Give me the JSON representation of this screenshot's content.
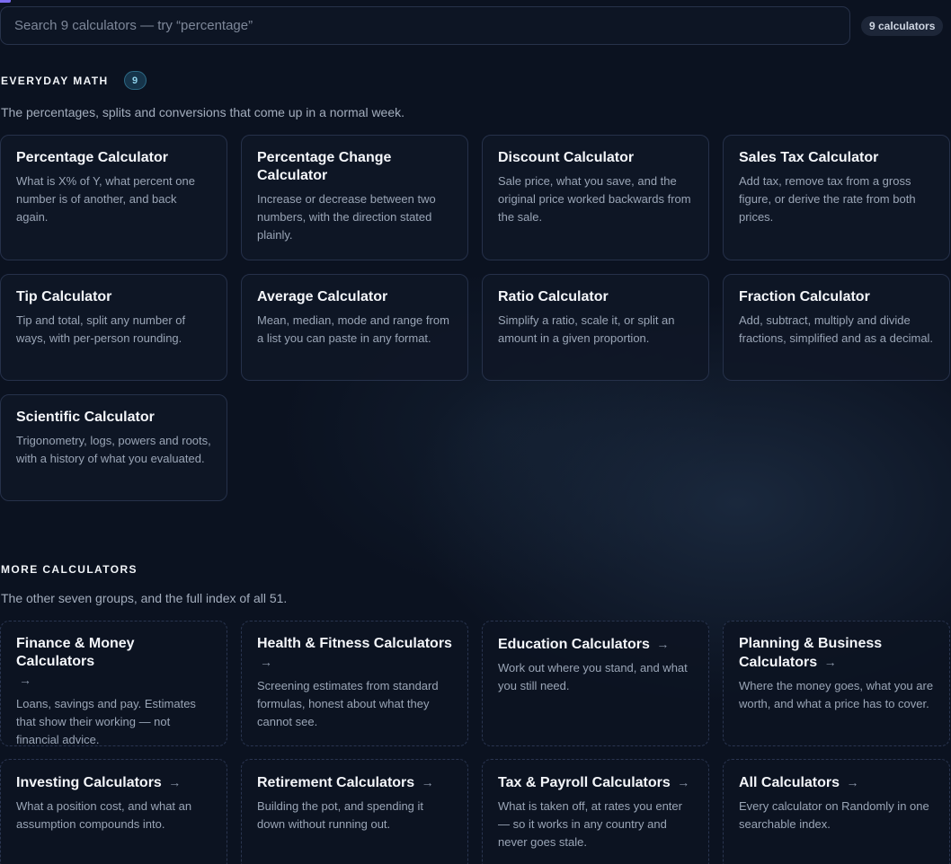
{
  "search": {
    "placeholder": "Search 9 calculators — try “percentage”",
    "count_label": "9 calculators"
  },
  "everyday": {
    "heading": "EVERYDAY MATH",
    "count": "9",
    "subtitle": "The percentages, splits and conversions that come up in a normal week.",
    "cards": [
      {
        "title": "Percentage Calculator",
        "desc": "What is X% of Y, what percent one number is of another, and back again."
      },
      {
        "title": "Percentage Change Calculator",
        "desc": "Increase or decrease between two numbers, with the direction stated plainly."
      },
      {
        "title": "Discount Calculator",
        "desc": "Sale price, what you save, and the original price worked backwards from the sale."
      },
      {
        "title": "Sales Tax Calculator",
        "desc": "Add tax, remove tax from a gross figure, or derive the rate from both prices."
      },
      {
        "title": "Tip Calculator",
        "desc": "Tip and total, split any number of ways, with per-person rounding."
      },
      {
        "title": "Average Calculator",
        "desc": "Mean, median, mode and range from a list you can paste in any format."
      },
      {
        "title": "Ratio Calculator",
        "desc": "Simplify a ratio, scale it, or split an amount in a given proportion."
      },
      {
        "title": "Fraction Calculator",
        "desc": "Add, subtract, multiply and divide fractions, simplified and as a decimal."
      },
      {
        "title": "Scientific Calculator",
        "desc": "Trigonometry, logs, powers and roots, with a history of what you evaluated."
      }
    ]
  },
  "more": {
    "heading": "MORE CALCULATORS",
    "subtitle": "The other seven groups, and the full index of all 51.",
    "arrow": "→",
    "cards": [
      {
        "title": "Finance & Money Calculators",
        "desc": "Loans, savings and pay. Estimates that show their working — not financial advice."
      },
      {
        "title": "Health & Fitness Calculators",
        "desc": "Screening estimates from standard formulas, honest about what they cannot see."
      },
      {
        "title": "Education Calculators",
        "desc": "Work out where you stand, and what you still need."
      },
      {
        "title": "Planning & Business Calculators",
        "desc": "Where the money goes, what you are worth, and what a price has to cover."
      },
      {
        "title": "Investing Calculators",
        "desc": "What a position cost, and what an assumption compounds into."
      },
      {
        "title": "Retirement Calculators",
        "desc": "Building the pot, and spending it down without running out."
      },
      {
        "title": "Tax & Payroll Calculators",
        "desc": "What is taken off, at rates you enter — so it works in any country and never goes stale."
      },
      {
        "title": "All Calculators",
        "desc": "Every calculator on Randomly in one searchable index."
      }
    ]
  }
}
